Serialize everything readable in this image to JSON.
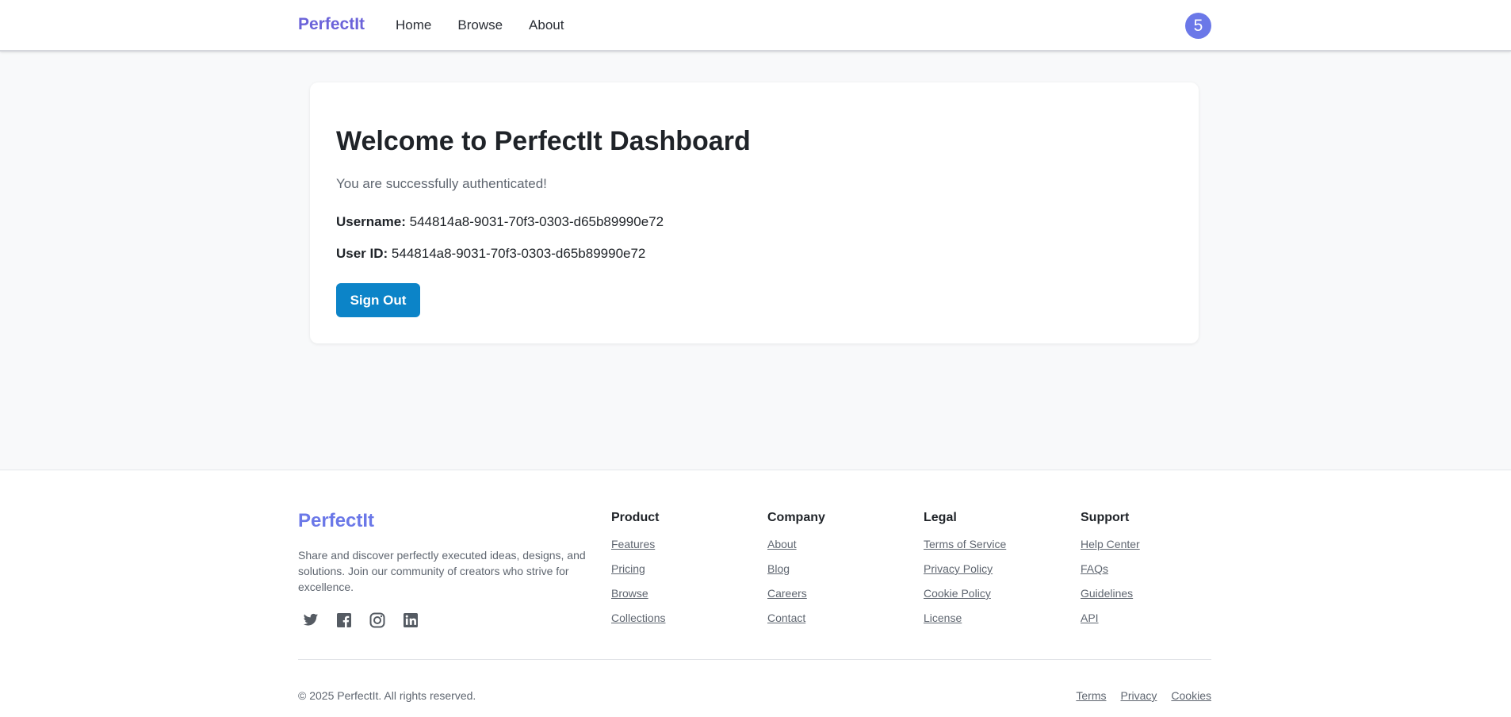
{
  "header": {
    "brand": "PerfectIt",
    "nav": [
      "Home",
      "Browse",
      "About"
    ],
    "avatar_initial": "5"
  },
  "card": {
    "title": "Welcome to PerfectIt Dashboard",
    "subtitle": "You are successfully authenticated!",
    "username_label": "Username:",
    "username_value": "544814a8-9031-70f3-0303-d65b89990e72",
    "userid_label": "User ID:",
    "userid_value": "544814a8-9031-70f3-0303-d65b89990e72",
    "signout_label": "Sign Out"
  },
  "footer": {
    "brand": "PerfectIt",
    "description": "Share and discover perfectly executed ideas, designs, and solutions. Join our community of creators who strive for excellence.",
    "socials": [
      "twitter-icon",
      "facebook-icon",
      "instagram-icon",
      "linkedin-icon"
    ],
    "columns": [
      {
        "title": "Product",
        "links": [
          "Features",
          "Pricing",
          "Browse",
          "Collections"
        ]
      },
      {
        "title": "Company",
        "links": [
          "About",
          "Blog",
          "Careers",
          "Contact"
        ]
      },
      {
        "title": "Legal",
        "links": [
          "Terms of Service",
          "Privacy Policy",
          "Cookie Policy",
          "License"
        ]
      },
      {
        "title": "Support",
        "links": [
          "Help Center",
          "FAQs",
          "Guidelines",
          "API"
        ]
      }
    ],
    "copyright": "© 2025 PerfectIt. All rights reserved.",
    "bottom_links": [
      "Terms",
      "Privacy",
      "Cookies"
    ]
  },
  "colors": {
    "brand": "#6b63d9",
    "avatar": "#6b78e8",
    "button": "#0c84c8"
  }
}
